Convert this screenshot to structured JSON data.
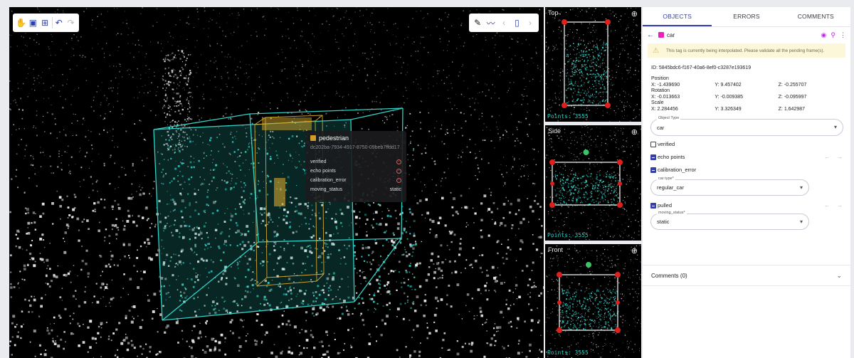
{
  "toolbar_left": {
    "icons": [
      "hand-icon",
      "add-box-icon",
      "crop-icon",
      "undo-icon",
      "redo-icon"
    ]
  },
  "toolbar_right": {
    "icons": [
      "pen-icon",
      "line-chart-icon",
      "prev-icon",
      "rectangle-icon",
      "next-icon"
    ]
  },
  "tooltip": {
    "title": "pedestrian",
    "id": "dc202ba-7934-4917-8750-09beb7ffdd17",
    "rows": [
      {
        "label": "verified",
        "value": ""
      },
      {
        "label": "echo points",
        "value": ""
      },
      {
        "label": "calibration_error",
        "value": ""
      },
      {
        "label": "moving_status",
        "value": "static"
      }
    ]
  },
  "views": {
    "top": {
      "label": "Top",
      "points": "Points: 3555"
    },
    "side": {
      "label": "Side",
      "points": "Points: 3555"
    },
    "front": {
      "label": "Front",
      "points": "Points: 3555"
    }
  },
  "panel": {
    "tabs": [
      "OBJECTS",
      "ERRORS",
      "COMMENTS"
    ],
    "object_name": "car",
    "object_color": "#e91ebc",
    "warning": "This tag is currently being interpolated. Please validate all the pending frame(s).",
    "id_line": "ID: 5845bdc6-f167-40a6-8ef0-c3287e193619",
    "position": {
      "label": "Position",
      "x": "X: -1.439690",
      "y": "Y: 9.457402",
      "z": "Z: -0.255707"
    },
    "rotation": {
      "label": "Rotation",
      "x": "X: -0.013663",
      "y": "Y: -0.009385",
      "z": "Z: -0.095997"
    },
    "scale": {
      "label": "Scale",
      "x": "X: 2.284456",
      "y": "Y: 3.326349",
      "z": "Z: 1.642987"
    },
    "object_type": {
      "legend": "Object Type",
      "value": "car"
    },
    "verified": "verified",
    "echo_points": "echo points",
    "calibration_error": "calibration_error",
    "car_type": {
      "legend": "car type*",
      "value": "regular_car"
    },
    "pulled": "pulled",
    "moving_status": {
      "legend": "moving_status*",
      "value": "static"
    },
    "comments": "Comments (0)"
  },
  "colors": {
    "accent": "#3341a8",
    "cyan": "#2fd1c6",
    "box_yellow": "#d4a72c",
    "warning_bg": "#fdf7d9"
  }
}
